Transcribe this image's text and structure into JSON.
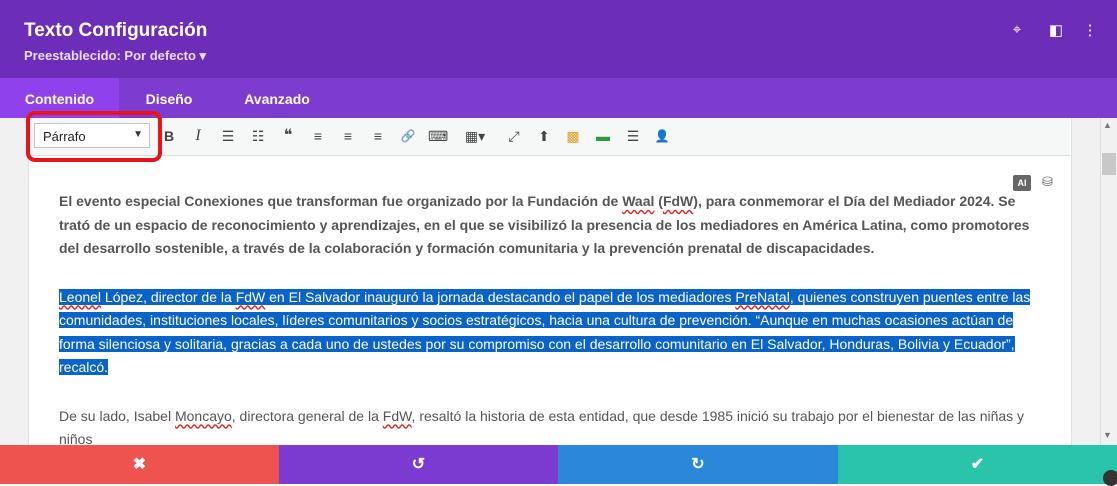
{
  "window": {
    "title": "Texto Configuración",
    "preset": "Preestablecido: Por defecto ▾",
    "colors": {
      "header": "#6c2eb9",
      "tabs": "#7e3bd0",
      "tab_active": "#8f42ec"
    }
  },
  "tabs": [
    {
      "label": "Contenido"
    },
    {
      "label": "Diseño"
    },
    {
      "label": "Avanzado"
    }
  ],
  "toolbar": {
    "format_value": "Párrafo",
    "format_arrow": "▼",
    "buttons": [
      {
        "name": "bold-icon",
        "glyph": "B"
      },
      {
        "name": "italic-icon",
        "glyph": "I"
      },
      {
        "name": "bullet-list-icon",
        "glyph": "☰"
      },
      {
        "name": "numbered-list-icon",
        "glyph": "☷"
      },
      {
        "name": "blockquote-icon",
        "glyph": "❝"
      },
      {
        "name": "align-left-icon",
        "glyph": "≡"
      },
      {
        "name": "align-center-icon",
        "glyph": "≡"
      },
      {
        "name": "align-right-icon",
        "glyph": "≡"
      },
      {
        "name": "link-icon",
        "glyph": "🔗"
      },
      {
        "name": "keyboard-icon",
        "glyph": "⌨"
      },
      {
        "name": "table-icon",
        "glyph": "▦▾"
      },
      {
        "name": "fullscreen-icon",
        "glyph": "⤢"
      },
      {
        "name": "insert-icon",
        "glyph": "⬆"
      },
      {
        "name": "modules-icon",
        "glyph": "▩"
      },
      {
        "name": "toggle-icon",
        "glyph": "▬"
      },
      {
        "name": "list-block-icon",
        "glyph": "☰"
      },
      {
        "name": "person-icon",
        "glyph": "👤"
      }
    ]
  },
  "editor": {
    "ai_label": "AI",
    "p1": {
      "a": "El evento especial Conexiones que transforman fue organizado por la Fundación de ",
      "waal": "Waal",
      "b": " (",
      "fdw": "FdW",
      "c": "), para conmemorar el Día del Mediador 2024. Se trató de un espacio de reconocimiento y aprendizajes, en el que se visibilizó la presencia de los mediadores en América Latina, como promotores del desarrollo sostenible, a través de la colaboración y formación comunitaria y la prevención prenatal de discapacidades."
    },
    "p2": {
      "leonel": "Leonel",
      "a": " López, director de la ",
      "fdw": "FdW",
      "b": " en El Salvador inauguró la jornada destacando el papel de los mediadores ",
      "prenatal": "PreNatal",
      "c": ", quienes construyen puentes  entre las comunidades, instituciones locales, líderes comunitarios y socios estratégicos, hacia una cultura de prevención. “Aunque en muchas ocasiones actúan de forma silenciosa y solitaria, gracias a cada uno de ustedes por su compromiso con el desarrollo comunitario en El Salvador, Honduras, Bolivia y Ecuador”, recalcó."
    },
    "p3": {
      "a": "De su lado, Isabel ",
      "moncayo": "Moncayo",
      "b": ", directora general de la ",
      "fdw": "FdW",
      "c": ", resaltó la historia de esta entidad, que desde 1985 inició su trabajo por el bienestar de las niñas y niños"
    }
  },
  "footer": {
    "discard": "✖",
    "undo": "↺",
    "redo": "↻",
    "save": "✔",
    "colors": {
      "discard": "#ef5350",
      "undo": "#7b3bd0",
      "redo": "#2b87da",
      "save": "#29c4a9"
    }
  }
}
